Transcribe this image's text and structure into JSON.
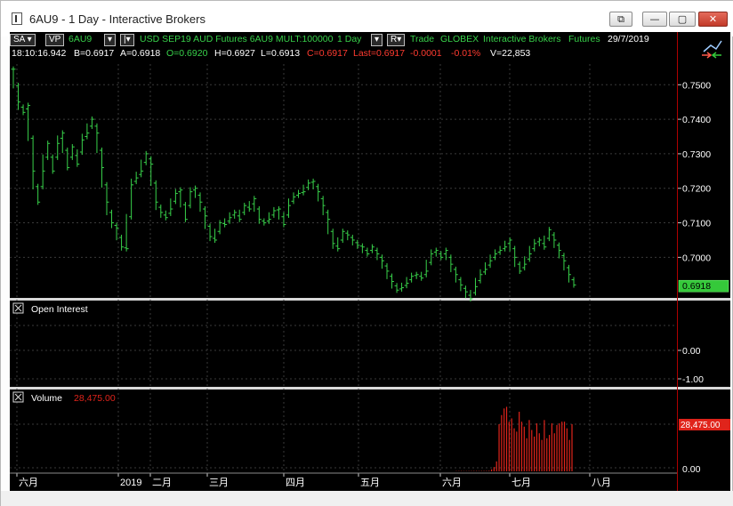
{
  "window": {
    "title": "6AU9 - 1 Day - Interactive Brokers",
    "detach_label": "⧉",
    "minimize_label": "—",
    "restore_label": "▢",
    "close_label": "✕"
  },
  "header": {
    "sa_button": "SA ▾",
    "vp_button": "VP",
    "symbol": "6AU9",
    "dropdown_glyph": "▾",
    "bar_glyph": "|▾",
    "description": "USD SEP19 AUD Futures 6AU9 MULT:100000",
    "period": "1 Day",
    "r_button": "R▾",
    "mode": "Trade",
    "exchange": "GLOBEX",
    "broker": "Interactive Brokers",
    "sectype": "Futures",
    "date": "29/7/2019",
    "time": "18:10:16.942",
    "bid": "B=0.6917",
    "ask": "A=0.6918",
    "open": "O=0.6920",
    "high": "H=0.6927",
    "low": "L=0.6913",
    "close": "C=0.6917",
    "last": "Last=0.6917",
    "change": "-0.0001",
    "change_pct": "-0.01%",
    "volume": "V=22,853"
  },
  "colors": {
    "background": "#000000",
    "price_bar": "#38d14a",
    "volume_bar": "#e0241b",
    "grid": "#3a3a3a",
    "divider": "#b00000",
    "last_price_tag": "#35c93a",
    "volume_tag": "#e0241b"
  },
  "chart_data": [
    {
      "type": "ohlc",
      "x_labels": [
        "六月",
        "2019",
        "二月",
        "三月",
        "四月",
        "五月",
        "六月",
        "七月",
        "八月"
      ],
      "y_ticks": [
        "0.7500",
        "0.7400",
        "0.7300",
        "0.7200",
        "0.7100",
        "0.7000"
      ],
      "ylim": [
        0.6885,
        0.756
      ],
      "last_price_label": "0.6918",
      "series": [
        {
          "values": [
            0.7545,
            0.745,
            0.742,
            0.744,
            0.725,
            0.716,
            0.725,
            0.733,
            0.725,
            0.733,
            0.736,
            0.726,
            0.732,
            0.727,
            0.734,
            0.736,
            0.74,
            0.736,
            0.726,
            0.716,
            0.71,
            0.7085,
            0.703,
            0.7025,
            0.721,
            0.723,
            0.725,
            0.73,
            0.727,
            0.716,
            0.713,
            0.7115,
            0.714,
            0.7185,
            0.7195,
            0.711,
            0.719,
            0.72,
            0.716,
            0.712,
            0.706,
            0.705,
            0.71,
            0.7095,
            0.7115,
            0.713,
            0.711,
            0.715,
            0.714,
            0.717,
            0.711,
            0.71,
            0.711,
            0.7135,
            0.714,
            0.7095,
            0.715,
            0.7175,
            0.7185,
            0.719,
            0.7215,
            0.722,
            0.719,
            0.715,
            0.711,
            0.704,
            0.7025,
            0.7075,
            0.7065,
            0.705,
            0.7035,
            0.703,
            0.701,
            0.703,
            0.701,
            0.699,
            0.696,
            0.693,
            0.6905,
            0.6912,
            0.6925,
            0.6945,
            0.695,
            0.694,
            0.696,
            0.701,
            0.702,
            0.7,
            0.702,
            0.698,
            0.695,
            0.692,
            0.69,
            0.688,
            0.6915,
            0.695,
            0.6965,
            0.699,
            0.701,
            0.702,
            0.703,
            0.705,
            0.7,
            0.696,
            0.698,
            0.701,
            0.704,
            0.705,
            0.703,
            0.708,
            0.705,
            0.702,
            0.699,
            0.695,
            0.692
          ]
        }
      ]
    },
    {
      "type": "line",
      "title": "Open Interest",
      "y_ticks": [
        "0.00",
        "-1.00"
      ],
      "series": []
    },
    {
      "type": "bar",
      "title": "Volume",
      "value_label": "28,475.00",
      "y_ticks": [
        "28,475.00",
        "0.00"
      ],
      "ylim": [
        0,
        43000
      ],
      "series": [
        {
          "values": [
            150,
            180,
            200,
            160,
            170,
            200,
            220,
            250,
            240,
            210,
            260,
            280,
            300,
            350,
            1200,
            2600,
            6000,
            28475,
            34000,
            38000,
            39000,
            30000,
            32000,
            26000,
            24000,
            36000,
            30000,
            27000,
            20000,
            31000,
            25000,
            21000,
            29000,
            23000,
            19000,
            31000,
            20000,
            22000,
            29000,
            23000,
            28000,
            29000,
            30000,
            30000,
            26000,
            19000,
            28475
          ]
        }
      ]
    }
  ],
  "panes": {
    "open_interest_title": "Open Interest",
    "volume_title": "Volume",
    "volume_value": "28,475.00"
  }
}
